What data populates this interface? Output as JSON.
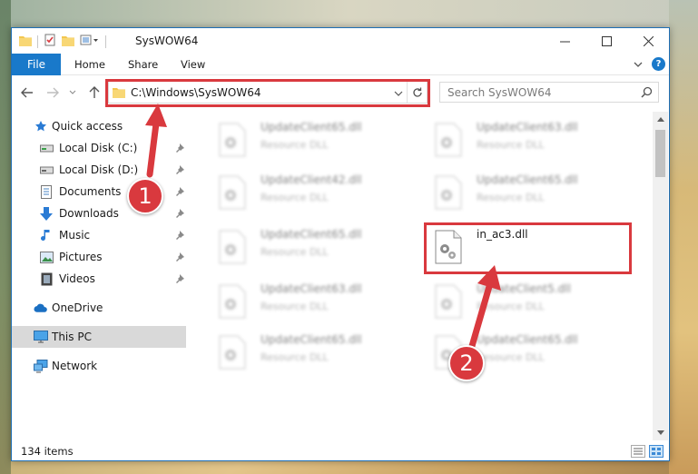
{
  "window": {
    "title": "SysWOW64"
  },
  "ribbon": {
    "file_label": "File",
    "tabs": [
      "Home",
      "Share",
      "View"
    ]
  },
  "address": {
    "path": "C:\\Windows\\SysWOW64"
  },
  "search": {
    "placeholder": "Search SysWOW64"
  },
  "sidebar": {
    "items": [
      {
        "label": "Quick access",
        "icon": "star-icon"
      },
      {
        "label": "Local Disk (C:)",
        "icon": "drive-icon"
      },
      {
        "label": "Local Disk (D:)",
        "icon": "drive-icon"
      },
      {
        "label": "Documents",
        "icon": "documents-icon"
      },
      {
        "label": "Downloads",
        "icon": "download-icon"
      },
      {
        "label": "Music",
        "icon": "music-icon"
      },
      {
        "label": "Pictures",
        "icon": "pictures-icon"
      },
      {
        "label": "Videos",
        "icon": "videos-icon"
      },
      {
        "label": "OneDrive",
        "icon": "cloud-icon"
      },
      {
        "label": "This PC",
        "icon": "computer-icon"
      },
      {
        "label": "Network",
        "icon": "network-icon"
      }
    ]
  },
  "files": [
    {
      "name": "UpdateClient65.dll",
      "type": "Resource DLL"
    },
    {
      "name": "UpdateClient63.dll",
      "type": "Resource DLL"
    },
    {
      "name": "UpdateClient42.dll",
      "type": "Resource DLL"
    },
    {
      "name": "UpdateClient65.dll",
      "type": "Resource DLL"
    },
    {
      "name": "UpdateClient65.dll",
      "type": "Resource DLL"
    },
    {
      "name": "in_ac3.dll",
      "type": ""
    },
    {
      "name": "UpdateClient63.dll",
      "type": "Resource DLL"
    },
    {
      "name": "UpdateClient5.dll",
      "type": "Resource DLL"
    },
    {
      "name": "UpdateClient65.dll",
      "type": "Resource DLL"
    },
    {
      "name": "UpdateClient65.dll",
      "type": "Resource DLL"
    }
  ],
  "status": {
    "item_count": "134 items"
  },
  "callouts": [
    "1",
    "2"
  ],
  "colors": {
    "accent": "#1979ca",
    "highlight": "#d9393e",
    "selected": "#d9d9d9"
  }
}
